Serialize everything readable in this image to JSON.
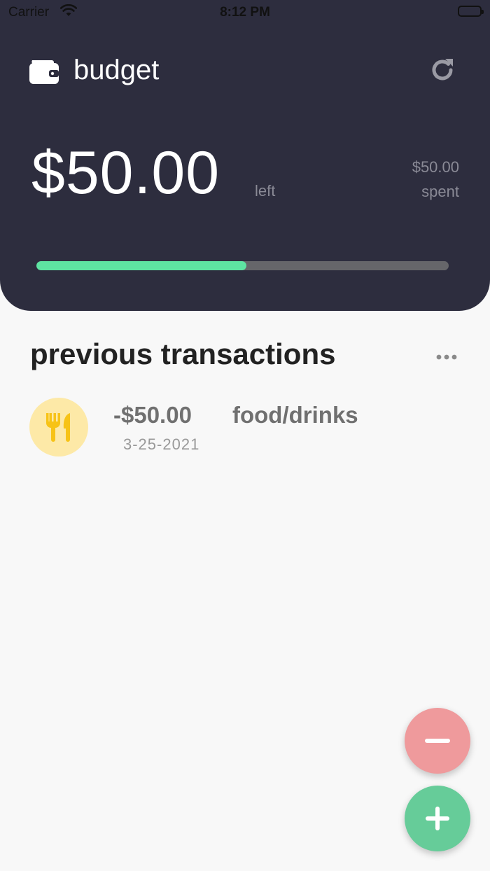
{
  "status_bar": {
    "carrier": "Carrier",
    "time": "8:12 PM"
  },
  "header": {
    "title": "budget",
    "icons": {
      "wallet": "wallet-icon",
      "refresh": "refresh-icon"
    },
    "amount_left": "$50.00",
    "left_label": "left",
    "spent_amount": "$50.00",
    "spent_label": "spent",
    "progress_fraction": 0.51
  },
  "transactions": {
    "title": "previous transactions",
    "more_icon": "more-horizontal-icon",
    "items": [
      {
        "amount": "-$50.00",
        "category": "food/drinks",
        "date": "3-25-2021",
        "icon": "utensils-icon"
      }
    ]
  },
  "actions": {
    "remove_icon": "minus-icon",
    "add_icon": "plus-icon"
  },
  "colors": {
    "header_bg": "#2d2d3e",
    "progress_fill": "#5ee3a2",
    "progress_track": "#66666a",
    "minus_button": "#ef9a9c",
    "plus_button": "#66cc99",
    "category_food_bg": "#fde9a7",
    "category_food_icon": "#f7c317"
  }
}
